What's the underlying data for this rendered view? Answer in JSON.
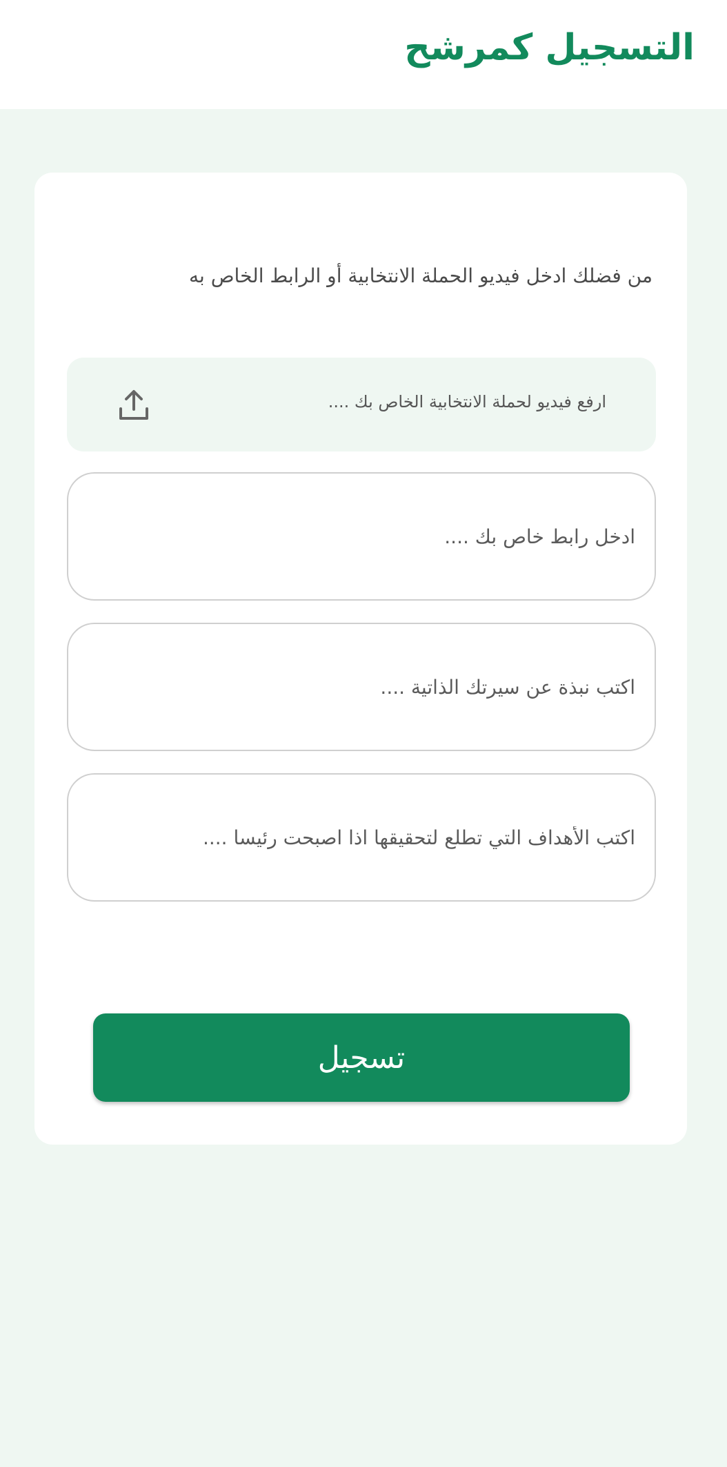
{
  "header": {
    "title": "التسجيل كمرشح"
  },
  "form": {
    "instruction": "من فضلك ادخل فيديو الحملة الانتخابية أو الرابط الخاص به",
    "upload": {
      "label": "ارفع فيديو لحملة الانتخابية الخاص بك ....",
      "icon": "upload-icon"
    },
    "fields": {
      "link_placeholder": "ادخل رابط خاص بك ....",
      "bio_placeholder": "اكتب نبذة عن سيرتك الذاتية ....",
      "goals_placeholder": "اكتب الأهداف التي تطلع لتحقيقها اذا اصبحت رئيسا ...."
    },
    "submit_label": "تسجيل"
  },
  "colors": {
    "brand": "#128a5c",
    "background": "#eff7f2"
  }
}
